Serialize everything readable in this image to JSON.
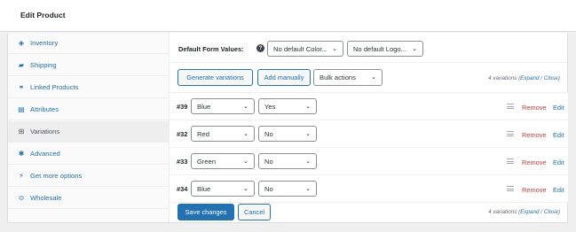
{
  "header": {
    "title": "Edit Product"
  },
  "sidebar": {
    "items": [
      {
        "label": "Inventory",
        "icon": "diamond-icon",
        "glyph": "◈",
        "active": false
      },
      {
        "label": "Shipping",
        "icon": "truck-icon",
        "glyph": "▰",
        "active": false
      },
      {
        "label": "Linked Products",
        "icon": "link-icon",
        "glyph": "⚭",
        "active": false
      },
      {
        "label": "Attributes",
        "icon": "list-icon",
        "glyph": "▤",
        "active": false
      },
      {
        "label": "Variations",
        "icon": "grid-icon",
        "glyph": "⊞",
        "active": true
      },
      {
        "label": "Advanced",
        "icon": "gear-icon",
        "glyph": "✱",
        "active": false
      },
      {
        "label": "Get more options",
        "icon": "plugin-icon",
        "glyph": "⚡",
        "active": false
      },
      {
        "label": "Wholesale",
        "icon": "wholesale-icon",
        "glyph": "≎",
        "active": false
      }
    ]
  },
  "defaults": {
    "label": "Default Form Values:",
    "color_value": "No default Color...",
    "logo_value": "No default Logo..."
  },
  "actions": {
    "generate_label": "Generate variations",
    "add_manually_label": "Add manually",
    "bulk_actions_label": "Bulk actions",
    "count_text": "4 variations",
    "expand_label": "Expand",
    "separator": "/",
    "close_label": "Close",
    "paren_open": "(",
    "paren_close": ")"
  },
  "variations": [
    {
      "id": "#39",
      "color": "Blue",
      "logo": "Yes"
    },
    {
      "id": "#32",
      "color": "Red",
      "logo": "No"
    },
    {
      "id": "#33",
      "color": "Green",
      "logo": "No"
    },
    {
      "id": "#34",
      "color": "Blue",
      "logo": "No"
    }
  ],
  "row_actions": {
    "remove_label": "Remove",
    "edit_label": "Edit"
  },
  "footer": {
    "save_label": "Save changes",
    "cancel_label": "Cancel"
  },
  "colors": {
    "accent": "#2271b1",
    "danger": "#d63638"
  }
}
